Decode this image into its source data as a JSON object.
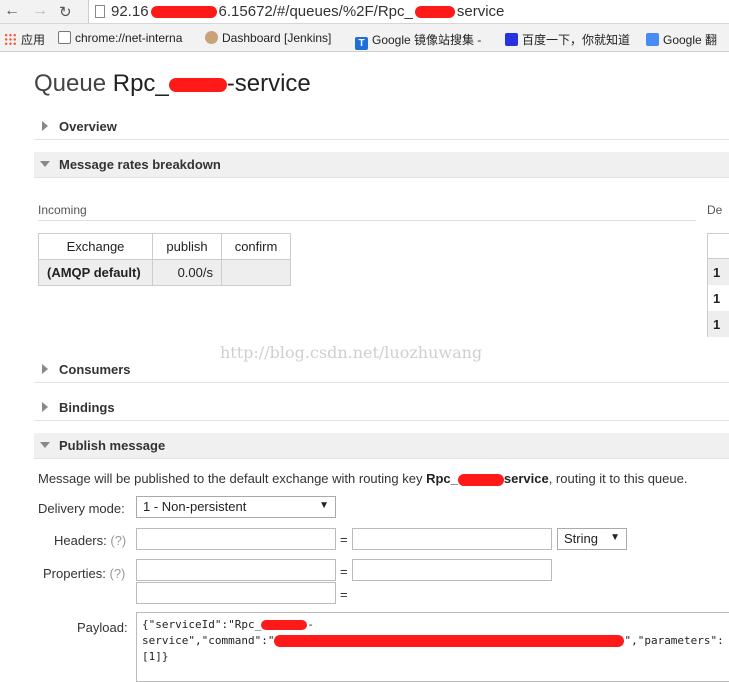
{
  "browser": {
    "url_prefix": "92.16",
    "url_mid": "6.15672/#/queues/%2F/Rpc_",
    "url_suffix": "service",
    "bookmarks": [
      {
        "label": "应用"
      },
      {
        "label": "chrome://net-interna"
      },
      {
        "label": "Dashboard [Jenkins]"
      },
      {
        "label": "Google 镜像站搜集 -"
      },
      {
        "label": "百度一下，你就知道"
      },
      {
        "label": "Google 翻"
      }
    ]
  },
  "page": {
    "title_prefix": "Queue",
    "queue_name_prefix": "Rpc_",
    "queue_name_suffix": "-service"
  },
  "sections": {
    "overview": "Overview",
    "rates": "Message rates breakdown",
    "consumers": "Consumers",
    "bindings": "Bindings",
    "publish": "Publish message"
  },
  "rates": {
    "incoming_label": "Incoming",
    "deliveries_label": "De",
    "columns": [
      "Exchange",
      "publish",
      "confirm"
    ],
    "rows": [
      {
        "exchange": "(AMQP default)",
        "publish": "0.00/s",
        "confirm": ""
      }
    ],
    "right_values": [
      "1",
      "1",
      "1"
    ]
  },
  "watermark": "http://blog.csdn.net/luozhuwang",
  "publish": {
    "desc_before": "Message will be published to the default exchange with routing key ",
    "routing_key_prefix": "Rpc_",
    "routing_key_suffix": "service",
    "desc_after": ", routing it to this queue.",
    "delivery_mode_label": "Delivery mode:",
    "delivery_mode_value": "1 - Non-persistent",
    "headers_label": "Headers:",
    "properties_label": "Properties:",
    "help": "(?)",
    "eq": "=",
    "header_type": "String",
    "payload_label": "Payload:",
    "payload_line1": "{\"serviceId\":\"Rpc_",
    "payload_line1_end": "-",
    "payload_line2_start": "service\",\"command\":\"",
    "payload_line2_end": "\",\"parameters\":",
    "payload_line3": "[1]}"
  },
  "colors": {
    "redaction": "#ff1a1a",
    "section_bg": "#f0f0f0"
  }
}
